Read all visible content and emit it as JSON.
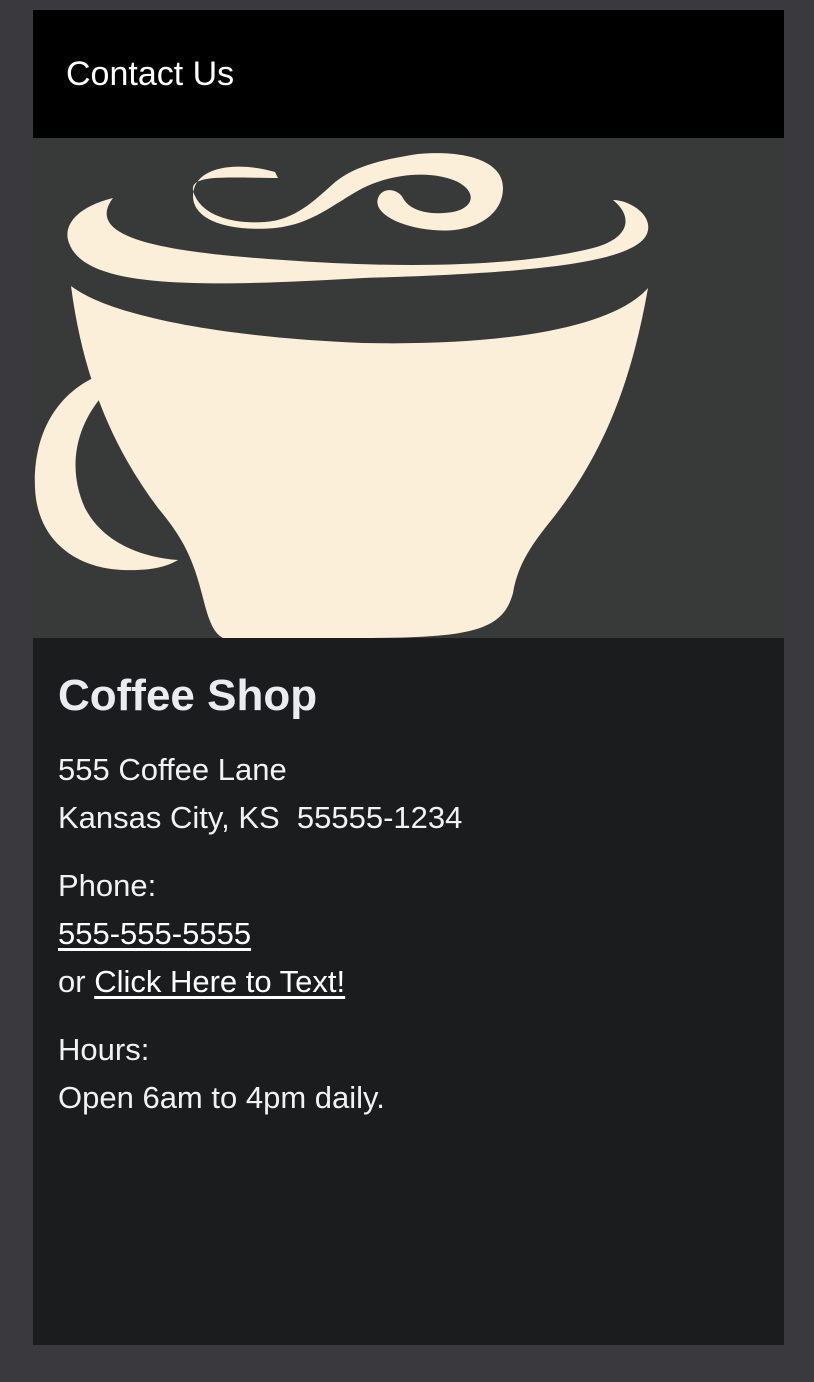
{
  "header": {
    "title": "Contact Us"
  },
  "hero": {
    "icon": "coffee-cup-icon",
    "colors": {
      "background": "#383a3a",
      "cup": "#fbefd9"
    }
  },
  "shop": {
    "name": "Coffee Shop",
    "address": {
      "line1": "555 Coffee Lane",
      "line2": "Kansas City, KS  55555-1234"
    },
    "phone": {
      "label": "Phone:",
      "number": "555-555-5555",
      "or_text": "or ",
      "text_link": "Click Here to Text!"
    },
    "hours": {
      "label": "Hours:",
      "value": "Open 6am to 4pm daily."
    }
  },
  "colors": {
    "page_background": "#3a3a3e",
    "header_background": "#000000",
    "content_background": "#1b1c1e",
    "text": "#f2f2f2"
  }
}
